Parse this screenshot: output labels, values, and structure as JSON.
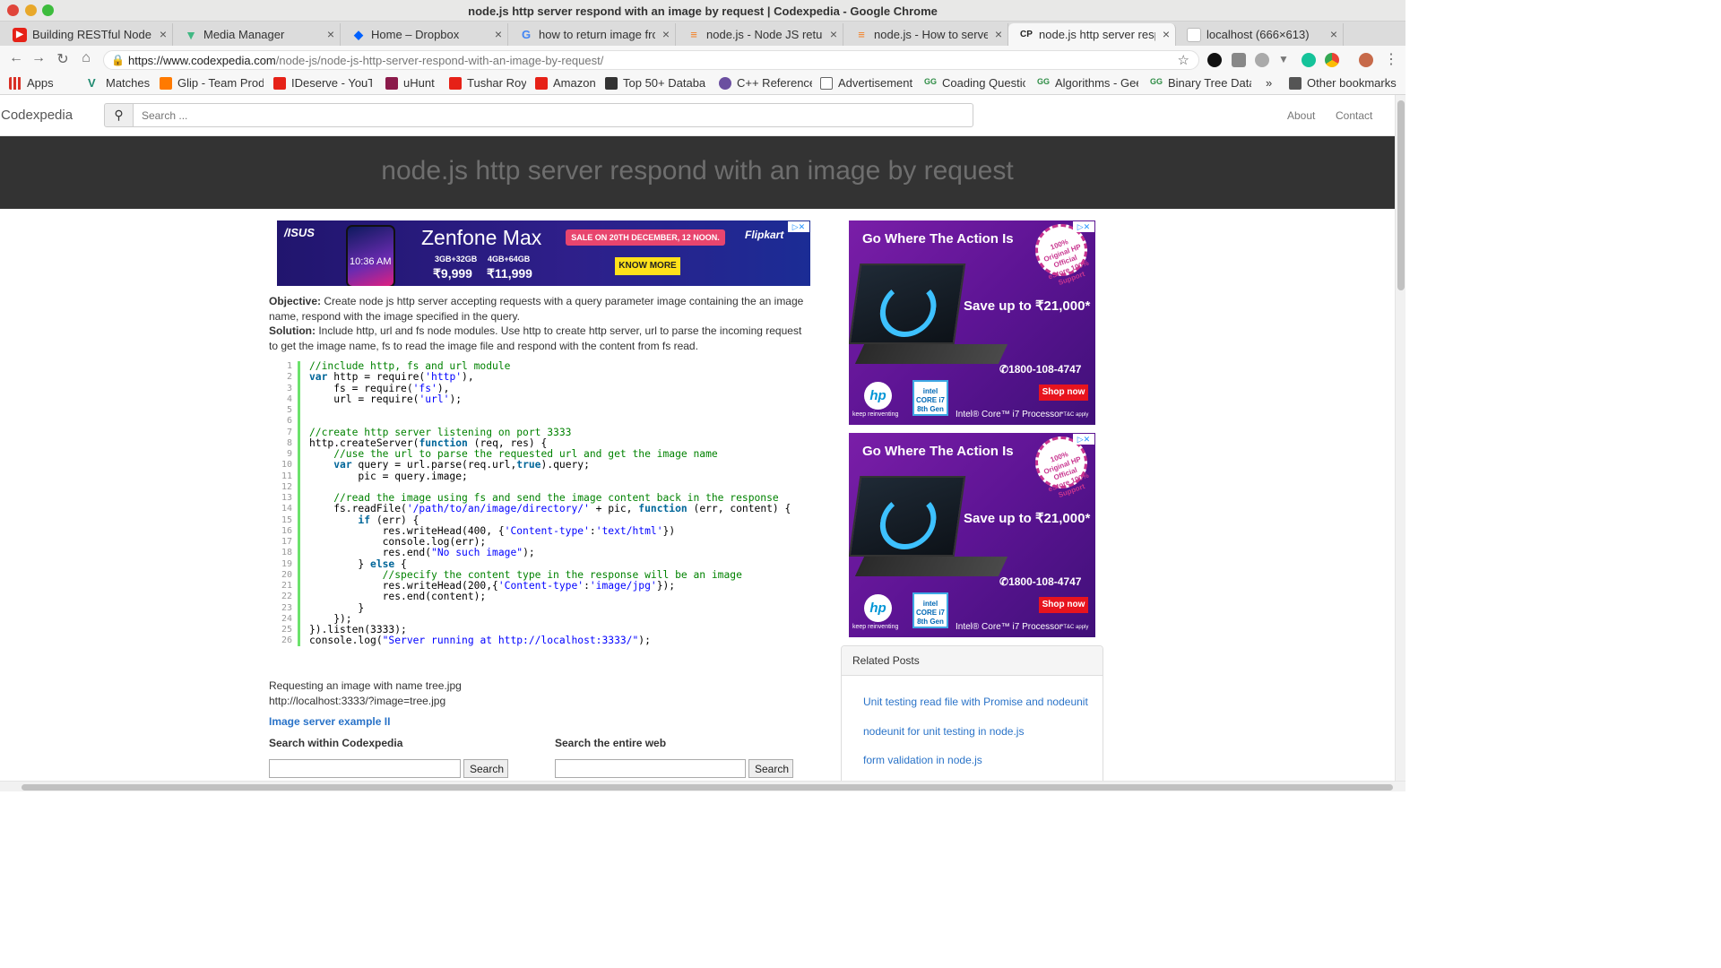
{
  "window": {
    "title": "node.js http server respond with an image by request | Codexpedia - Google Chrome"
  },
  "tabs": [
    {
      "label": "Building RESTful Node.js",
      "icon": "youtube-icon",
      "color": "#e62117"
    },
    {
      "label": "Media Manager",
      "icon": "vue-icon",
      "color": "#41b883"
    },
    {
      "label": "Home – Dropbox",
      "icon": "dropbox-icon",
      "color": "#0061ff"
    },
    {
      "label": "how to return image fro",
      "icon": "google-icon",
      "color": "#4285f4"
    },
    {
      "label": "node.js - Node JS return",
      "icon": "stackoverflow-icon",
      "color": "#f48024"
    },
    {
      "label": "node.js - How to serve a",
      "icon": "stackoverflow-icon",
      "color": "#f48024"
    },
    {
      "label": "node.js http server resp",
      "icon": "codexpedia-icon",
      "color": "#222222"
    },
    {
      "label": "localhost (666×613)",
      "icon": "page-icon",
      "color": "#bbbbbb"
    }
  ],
  "newtab_label": "+",
  "address": {
    "host": "https://www.codexpedia.com",
    "path": "/node-js/node-js-http-server-respond-with-an-image-by-request/"
  },
  "bookmarks": [
    {
      "label": "Apps",
      "icon": "apps-grid-icon",
      "color": "#d93025"
    },
    {
      "label": "",
      "icon": "youtube-icon",
      "color": "#e62117"
    },
    {
      "label": "Matches",
      "icon": "matches-icon",
      "color": "#1f8a70"
    },
    {
      "label": "Glip - Team Prod",
      "icon": "glip-icon",
      "color": "#ff7a00"
    },
    {
      "label": "IDeserve - YouTu",
      "icon": "youtube-icon",
      "color": "#e62117"
    },
    {
      "label": "uHunt",
      "icon": "uhunt-icon",
      "color": "#8b1a4a"
    },
    {
      "label": "Tushar Roy",
      "icon": "youtube-icon",
      "color": "#e62117"
    },
    {
      "label": "Amazon",
      "icon": "youtube-icon",
      "color": "#e62117"
    },
    {
      "label": "Top 50+ Databas",
      "icon": "database-icon",
      "color": "#333333"
    },
    {
      "label": "C++ Reference",
      "icon": "cpp-icon",
      "color": "#6b4fa0"
    },
    {
      "label": "Advertisement",
      "icon": "page-icon",
      "color": "#ffffff"
    },
    {
      "label": "Coading Questic",
      "icon": "gfg-icon",
      "color": "#2f8d46"
    },
    {
      "label": "Algorithms - Gee",
      "icon": "gfg-icon",
      "color": "#2f8d46"
    },
    {
      "label": "Binary Tree Data",
      "icon": "gfg-icon",
      "color": "#2f8d46"
    }
  ],
  "bookmarks_more": "»",
  "other_bookmarks": "Other bookmarks",
  "site": {
    "brand": "Codexpedia",
    "search_placeholder": "Search ...",
    "nav": [
      "About",
      "Contact"
    ],
    "title": "node.js http server respond with an image by request"
  },
  "ad_top": {
    "brand": "/ISUS",
    "product": "Zenfone Max",
    "phone_time": "10:36 AM",
    "sale": "SALE ON 20TH DECEMBER, 12 NOON.",
    "spec1": "3GB+32GB",
    "spec2": "4GB+64GB",
    "price1": "₹9,999",
    "price2": "₹11,999",
    "cta": "KNOW MORE",
    "store": "Flipkart"
  },
  "article": {
    "objective_label": "Objective:",
    "objective": " Create node js http server accepting requests with a query parameter image containing the an image name, respond with the image specified in the query.",
    "solution_label": "Solution:",
    "solution": " Include http, url and fs node modules. Use http to create http server, url to parse the incoming request to get the image name, fs to read the image file and respond with the content from fs read."
  },
  "code_lines": [
    "//include http, fs and url module",
    "var http = require('http'),",
    "    fs = require('fs'),",
    "    url = require('url');",
    "",
    "",
    "//create http server listening on port 3333",
    "http.createServer(function (req, res) {",
    "    //use the url to parse the requested url and get the image name",
    "    var query = url.parse(req.url,true).query;",
    "        pic = query.image;",
    "",
    "    //read the image using fs and send the image content back in the response",
    "    fs.readFile('/path/to/an/image/directory/' + pic, function (err, content) {",
    "        if (err) {",
    "            res.writeHead(400, {'Content-type':'text/html'})",
    "            console.log(err);",
    "            res.end(\"No such image\");",
    "        } else {",
    "            //specify the content type in the response will be an image",
    "            res.writeHead(200,{'Content-type':'image/jpg'});",
    "            res.end(content);",
    "        }",
    "    });",
    "}).listen(3333);",
    "console.log(\"Server running at http://localhost:3333/\");"
  ],
  "request": {
    "line1": "Requesting an image with name tree.jpg",
    "line2": "http://localhost:3333/?image=tree.jpg"
  },
  "next_link": "Image server example II",
  "search_site": {
    "label": "Search within Codexpedia",
    "button": "Search"
  },
  "search_web": {
    "label": "Search the entire web",
    "button": "Search"
  },
  "side_ad": {
    "headline": "Go Where The Action Is",
    "seal": "100% Original HP Official eStore 100% Support",
    "offer": "Save up to ₹21,000*",
    "phone": "1800-108-4747",
    "cta": "Shop now",
    "hp_logo": "hp",
    "tagline": "keep reinventing",
    "intel_badge": "intel CORE i7 8th Gen",
    "processor": "Intel® Core™ i7 Processor",
    "terms": "*T&C apply"
  },
  "related": {
    "title": "Related Posts",
    "items": [
      "Unit testing read file with Promise and nodeunit",
      "nodeunit for unit testing in node.js",
      "form validation in node.js"
    ]
  }
}
